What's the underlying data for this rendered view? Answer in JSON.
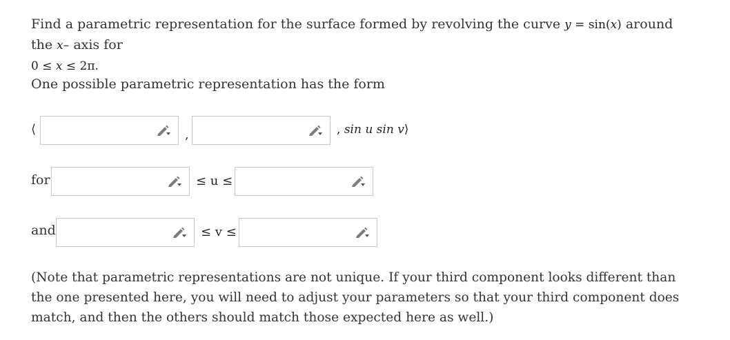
{
  "question": {
    "line1_pre": "Find a parametric representation for the surface formed by revolving the curve",
    "curve_lhs": "y",
    "curve_eq": " = sin(",
    "curve_var": "x",
    "curve_close": ")",
    "line1_mid": "around the",
    "axis_var": "x",
    "axis_dash": "–",
    "line1_post": "axis for",
    "range_lo": "0 ≤ ",
    "range_var": "x",
    "range_hi": " ≤ 2π."
  },
  "intro": "One possible parametric representation has the form",
  "vector": {
    "open": "⟨",
    "comma1": ",",
    "comma2": ",",
    "third": "sin u sin v",
    "close": "⟩"
  },
  "for_label": "for",
  "u_ineq": "≤ u ≤",
  "and_label": "and",
  "v_ineq": "≤ v ≤",
  "note": "(Note that parametric representations are not unique. If your third component looks different than the one presented here, you will need to adjust your parameters so that your third component does match, and then the others should match those expected here as well.)",
  "fields": {
    "comp1": "",
    "comp2": "",
    "u_min": "",
    "u_max": "",
    "v_min": "",
    "v_max": ""
  },
  "icons": {
    "edit": "pencil-icon"
  }
}
